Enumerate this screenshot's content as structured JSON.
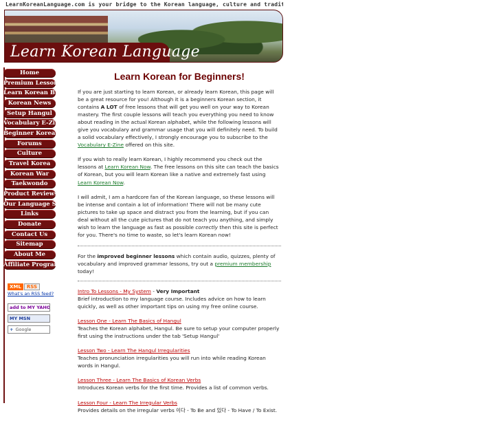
{
  "header": {
    "tagline": "LearnKoreanLanguage.com is your bridge to the Korean language, culture and traditions...",
    "banner_title": "Learn Korean Language"
  },
  "nav": {
    "items": [
      {
        "label": "Home"
      },
      {
        "label": "Premium Lessons"
      },
      {
        "label": "Learn Korean Blog"
      },
      {
        "label": "Korean News"
      },
      {
        "label": "Setup Hangul"
      },
      {
        "label": "Vocabulary E-Zine"
      },
      {
        "label": "Beginner Korean"
      },
      {
        "label": "Forums"
      },
      {
        "label": "Culture"
      },
      {
        "label": "Travel Korea"
      },
      {
        "label": "Korean War"
      },
      {
        "label": "Taekwondo"
      },
      {
        "label": "Product Reviews"
      },
      {
        "label": "Our Language Store"
      },
      {
        "label": "Links"
      },
      {
        "label": "Donate"
      },
      {
        "label": "Contact Us"
      },
      {
        "label": "Sitemap"
      },
      {
        "label": "About Me"
      },
      {
        "label": "Affiliate Program"
      }
    ]
  },
  "badges": {
    "xml": "XML",
    "rss": "RSS",
    "rss_help": "What's an RSS feed?",
    "yahoo": "add to MY YAHOO!",
    "msn": "MY MSN",
    "google_plus": "+",
    "google": "Google"
  },
  "main": {
    "title": "Learn Korean for Beginners!",
    "p1_a": "If you are just starting to learn Korean, or already learn Korean, this page will be a great resource for you! Although it is a beginners Korean section, it contains ",
    "p1_bold": "A LOT",
    "p1_b": " of free lessons that will get you well on your way to Korean mastery. The first couple lessons will teach you everything you need to know about reading in the actual Korean alphabet, while the following lessons will give you vocabulary and grammar usage that you will definitely need. To build a solid vocabulary effectively, I strongly encourage you to subscribe to the ",
    "p1_link": "Vocabulary E-Zine",
    "p1_c": " offered on this site.",
    "p2_a": "If you wish to really learn Korean, I highly recommend you check out the lessons at ",
    "p2_link1": "Learn Korean Now",
    "p2_b": ". The free lessons on this site can teach the basics of Korean, but you will learn Korean like a native and extremely fast using ",
    "p2_link2": "Learn Korean Now",
    "p2_c": ".",
    "p3_a": "I will admit, I am a hardcore fan of the Korean language, so these lessons will be intense and contain a lot of information! There will not be many cute pictures to take up space and distract you from the learning, but if you can deal without all the cute pictures that do not teach you anything, and simply wish to learn the language as fast as possible ",
    "p3_em": "correctly",
    "p3_b": " then this site is perfect for you. There's no time to waste, so let's learn Korean now!",
    "p4_a": "For the ",
    "p4_bold": "improved beginner lessons",
    "p4_b": " which contain audio, quizzes, plenty of vocabulary and improved grammar lessons, try out a ",
    "p4_link": "premium membership",
    "p4_c": " today!",
    "lessons": [
      {
        "title": "Intro To Lessons - My System",
        "sep": " - ",
        "tag": "Very Important",
        "desc": "Brief introduction to my language course. Includes advice on how to learn quickly, as well as other important tips on using my free online course."
      },
      {
        "title": "Lesson One - Learn The Basics of Hangul",
        "desc": "Teaches the Korean alphabet, Hangul. Be sure to setup your computer properly first using the instructions under the tab 'Setup Hangul'"
      },
      {
        "title": "Lesson Two - Learn The Hangul Irregularities",
        "desc": "Teaches pronunciation irregularities you will run into while reading Korean words in Hangul."
      },
      {
        "title": "Lesson Three - Learn The Basics of Korean Verbs",
        "desc": "Introduces Korean verbs for the first time. Provides a list of common verbs."
      },
      {
        "title": "Lesson Four - Learn The Irregular Verbs",
        "desc": "Provides details on the irregular verbs 이다 - To Be and 있다 - To Have / To Exist."
      }
    ]
  }
}
